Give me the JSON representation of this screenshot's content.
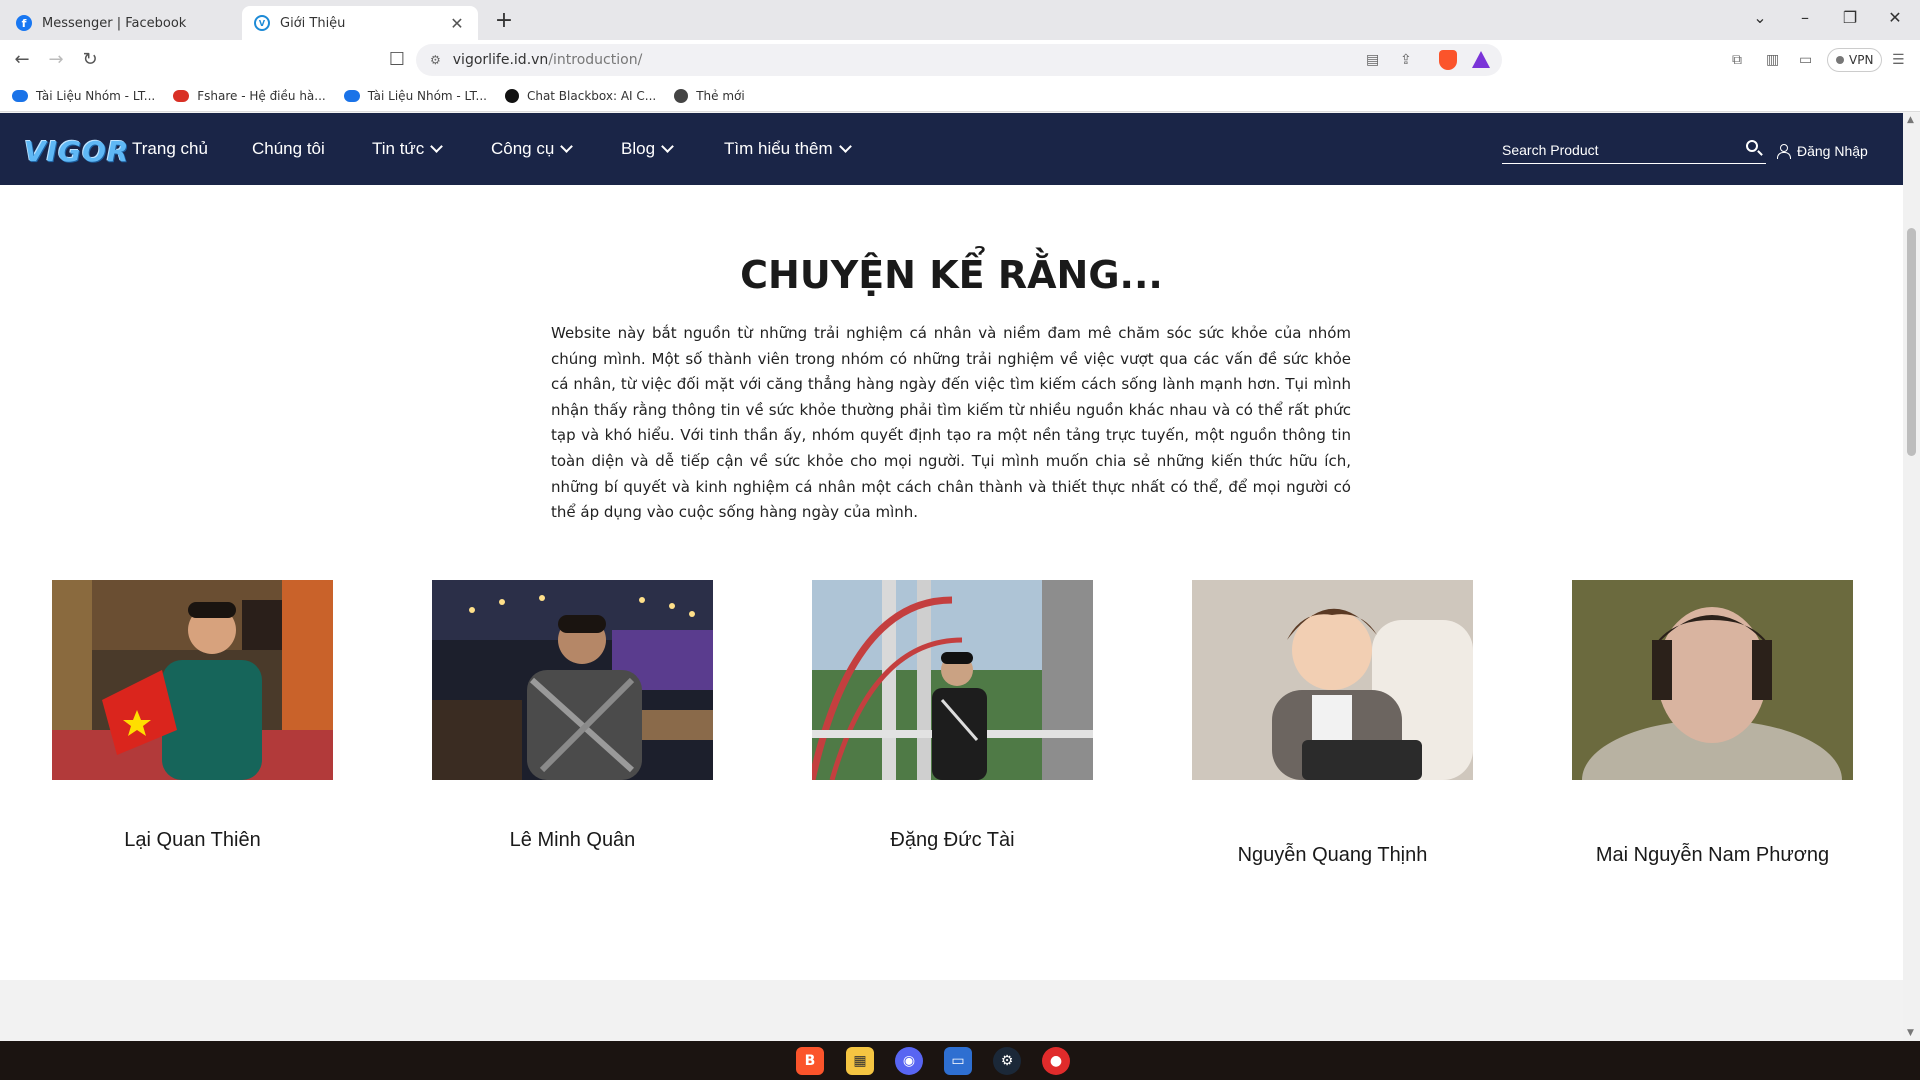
{
  "browser": {
    "tabs": [
      {
        "title": "Messenger | Facebook",
        "active": false
      },
      {
        "title": "Giới Thiệu",
        "active": true
      }
    ],
    "url": {
      "domain": "vigorlife.id.vn",
      "path": "/introduction/"
    },
    "vpn_label": "VPN",
    "bookmarks": [
      {
        "label": "Tài Liệu Nhóm - LT...",
        "color": "#1a73e8"
      },
      {
        "label": "Fshare - Hệ điều hà...",
        "color": "#d93025"
      },
      {
        "label": "Tài Liệu Nhóm - LT...",
        "color": "#1a73e8"
      },
      {
        "label": "Chat Blackbox: AI C...",
        "color": "#111111"
      },
      {
        "label": "Thẻ mới",
        "color": "#444444"
      }
    ]
  },
  "site": {
    "logo": "VIGOR",
    "nav": [
      {
        "label": "Trang chủ",
        "dropdown": false
      },
      {
        "label": "Chúng tôi",
        "dropdown": false
      },
      {
        "label": "Tin tức",
        "dropdown": true
      },
      {
        "label": "Công cụ",
        "dropdown": true
      },
      {
        "label": "Blog",
        "dropdown": true
      },
      {
        "label": "Tìm hiểu thêm",
        "dropdown": true
      }
    ],
    "search_placeholder": "Search Product",
    "login_label": "Đăng Nhập",
    "colors": {
      "nav_bg": "#1a2547",
      "text": "#1a1a1a"
    }
  },
  "story": {
    "title": "CHUYỆN KỂ RẰNG...",
    "body": "Website này bắt nguồn từ những trải nghiệm cá nhân và niềm đam mê chăm sóc sức khỏe của nhóm chúng mình. Một số thành viên trong nhóm có những trải nghiệm về việc vượt qua các vấn đề sức khỏe cá nhân, từ việc đối mặt với căng thẳng hàng ngày đến việc tìm kiếm cách sống lành mạnh hơn. Tụi mình nhận thấy rằng thông tin về sức khỏe thường phải tìm kiếm từ nhiều nguồn khác nhau và có thể rất phức tạp và khó hiểu. Với tinh thần ấy, nhóm quyết định tạo ra một nền tảng trực tuyến, một nguồn thông tin toàn diện và dễ tiếp cận về sức khỏe cho mọi người. Tụi mình muốn chia sẻ những kiến thức hữu ích, những bí quyết và kinh nghiệm cá nhân một cách chân thành và thiết thực nhất có thể, để mọi người có thể áp dụng vào cuộc sống hàng ngày của mình."
  },
  "members": [
    {
      "name": "Lại Quan Thiên"
    },
    {
      "name": "Lê Minh Quân"
    },
    {
      "name": "Đặng Đức Tài"
    },
    {
      "name": "Nguyễn Quang Thịnh"
    },
    {
      "name": "Mai Nguyễn Nam Phương"
    }
  ],
  "taskbar": {
    "apps": [
      "brave-icon",
      "file-explorer-icon",
      "discord-icon",
      "pc-icon",
      "steam-icon",
      "app-icon"
    ]
  }
}
